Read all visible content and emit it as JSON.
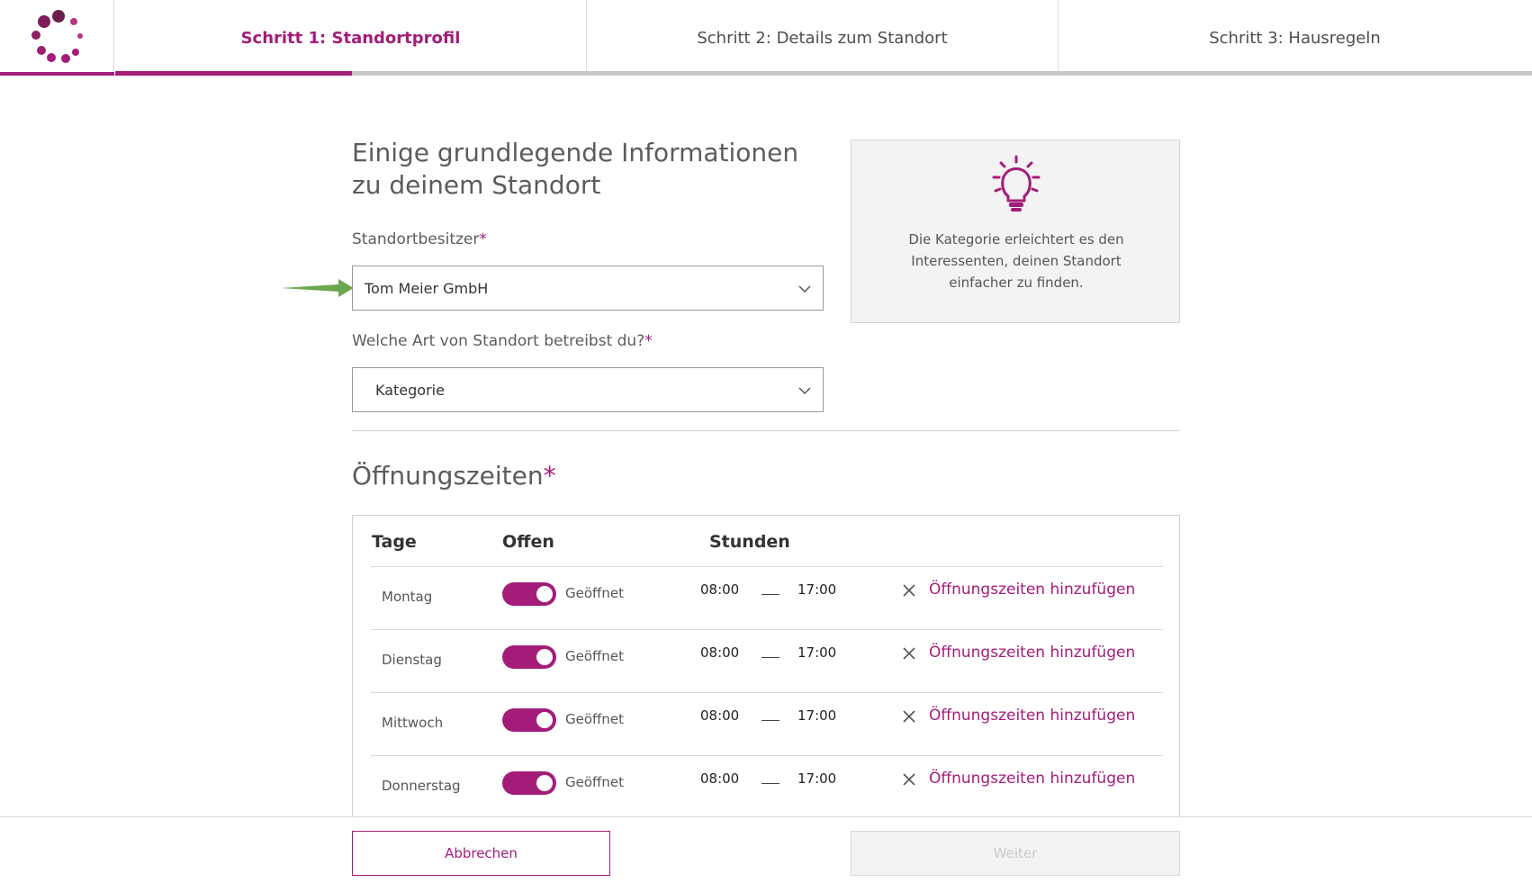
{
  "steps": [
    {
      "label": "Schritt 1: Standortprofil",
      "active": true
    },
    {
      "label": "Schritt 2: Details zum Standort",
      "active": false
    },
    {
      "label": "Schritt 3: Hausregeln",
      "active": false
    }
  ],
  "progress_fraction": 0.167,
  "colors": {
    "accent": "#a41c7a",
    "arrow": "#6aa84f"
  },
  "form": {
    "heading": "Einige grundlegende Informationen zu deinem Standort",
    "owner_label": "Standortbesitzer",
    "owner_value": "Tom Meier GmbH",
    "type_label": "Welche Art von Standort betreibst du?",
    "type_value": "Kategorie",
    "required_marker": "*"
  },
  "tip": {
    "icon": "lightbulb-icon",
    "text": "Die Kategorie erleichtert es den Interessenten, deinen Standort einfacher zu finden."
  },
  "hours": {
    "title": "Öffnungszeiten",
    "columns": {
      "days": "Tage",
      "open": "Offen",
      "hours": "Stunden"
    },
    "rows": [
      {
        "day": "Montag",
        "status": "Geöffnet",
        "from": "08:00",
        "to": "17:00",
        "add_label": "Öffnungszeiten hinzufügen",
        "open": true
      },
      {
        "day": "Dienstag",
        "status": "Geöffnet",
        "from": "08:00",
        "to": "17:00",
        "add_label": "Öffnungszeiten hinzufügen",
        "open": true
      },
      {
        "day": "Mittwoch",
        "status": "Geöffnet",
        "from": "08:00",
        "to": "17:00",
        "add_label": "Öffnungszeiten hinzufügen",
        "open": true
      },
      {
        "day": "Donnerstag",
        "status": "Geöffnet",
        "from": "08:00",
        "to": "17:00",
        "add_label": "Öffnungszeiten hinzufügen",
        "open": true
      }
    ]
  },
  "footer": {
    "cancel_label": "Abbrechen",
    "next_label": "Weiter"
  }
}
